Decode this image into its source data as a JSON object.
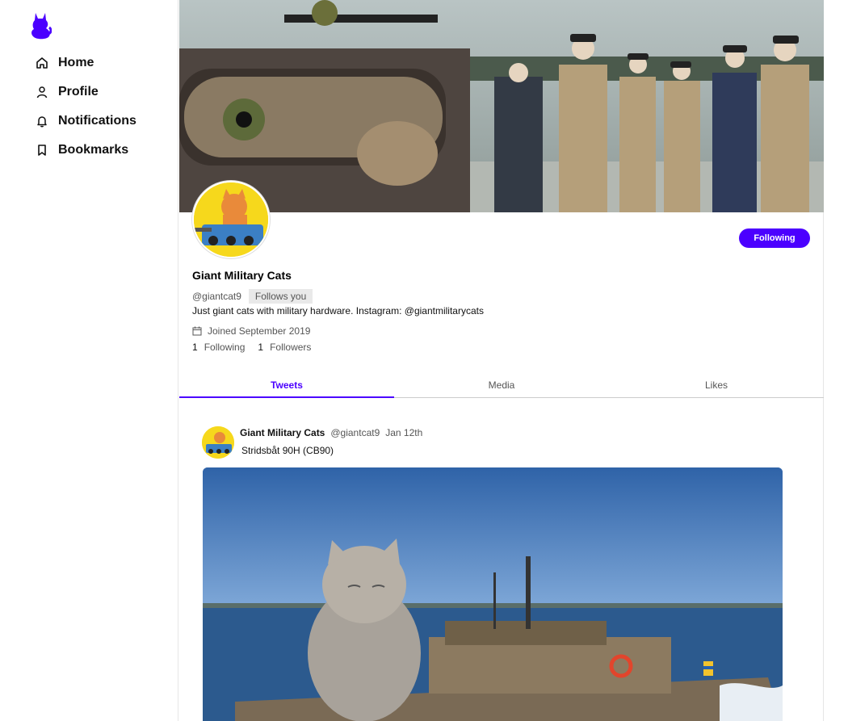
{
  "colors": {
    "accent": "#4b00ff",
    "muted": "#555555",
    "border": "#e6e6e6"
  },
  "sidebar": {
    "logo_icon": "cat-logo-icon",
    "items": [
      {
        "label": "Home",
        "icon": "home-icon"
      },
      {
        "label": "Profile",
        "icon": "user-icon"
      },
      {
        "label": "Notifications",
        "icon": "bell-icon"
      },
      {
        "label": "Bookmarks",
        "icon": "bookmark-icon"
      }
    ]
  },
  "profile": {
    "name": "Giant Military Cats",
    "handle": "@giantcat9",
    "follows_you": "Follows you",
    "bio": "Just giant cats with military hardware. Instagram: @giantmilitarycats",
    "joined": "Joined September 2019",
    "following_count": "1",
    "following_label": "Following",
    "followers_count": "1",
    "followers_label": "Followers",
    "follow_button": "Following"
  },
  "tabs": [
    {
      "label": "Tweets",
      "active": true
    },
    {
      "label": "Media",
      "active": false
    },
    {
      "label": "Likes",
      "active": false
    }
  ],
  "tweet": {
    "name": "Giant Military Cats",
    "handle": "@giantcat9",
    "date": "Jan 12th",
    "text": "Stridsbåt 90H (CB90)"
  }
}
